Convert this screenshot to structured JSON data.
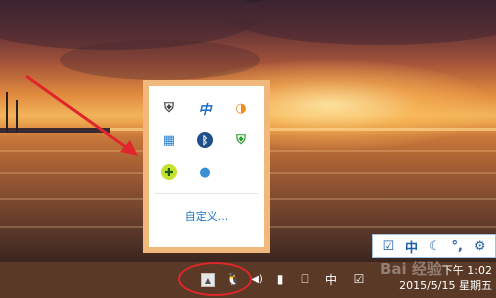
{
  "overflow_panel": {
    "customize_label": "自定义...",
    "icons": [
      {
        "name": "shield-icon",
        "glyph": "⛨",
        "color": "#444444"
      },
      {
        "name": "ime-zhong-icon",
        "glyph": "中",
        "color": "#1e6fc4"
      },
      {
        "name": "browser-icon",
        "glyph": "◑",
        "color": "#f08a1a"
      },
      {
        "name": "network-monitor-icon",
        "glyph": "▦",
        "color": "#2a7fd0"
      },
      {
        "name": "bluetooth-icon",
        "glyph": "ᛒ",
        "color": "#1f4f8a"
      },
      {
        "name": "security-shield-icon",
        "glyph": "⛨",
        "color": "#2f9e2f"
      },
      {
        "name": "plus-antivirus-icon",
        "glyph": "✚",
        "color": "#7fbf1e"
      },
      {
        "name": "cloud-icon",
        "glyph": "●",
        "color": "#3a8fd8"
      }
    ]
  },
  "langbar": {
    "items": [
      {
        "name": "check-icon",
        "glyph": "☑"
      },
      {
        "name": "ime-zhong-label",
        "glyph": "中"
      },
      {
        "name": "moon-icon",
        "glyph": "☾"
      },
      {
        "name": "punctuation-icon",
        "glyph": "°,"
      },
      {
        "name": "gear-icon",
        "glyph": "⚙"
      }
    ]
  },
  "taskbar": {
    "show_hidden_glyph": "▲",
    "qq_glyph": "🐧",
    "volume_glyph": "◀)",
    "battery_glyph": "▮",
    "network_glyph": "⎕",
    "ime_label": "中",
    "action_center_glyph": "☑",
    "time": "下午 1:02",
    "date": "2015/5/15 星期五",
    "watermark": "Bai 经验"
  }
}
